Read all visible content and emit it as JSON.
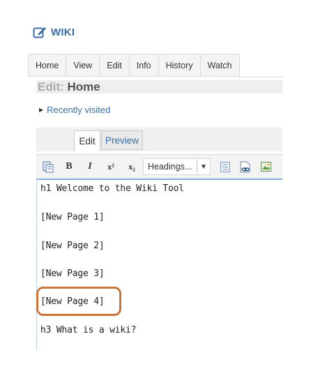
{
  "wiki": {
    "title": "WIKI",
    "icon": "edit-icon"
  },
  "tabs": [
    "Home",
    "View",
    "Edit",
    "Info",
    "History",
    "Watch"
  ],
  "edit_heading": {
    "prefix": "Edit:",
    "page": "Home"
  },
  "recent": {
    "label": "Recently visited"
  },
  "editor_tabs": {
    "edit": "Edit",
    "preview": "Preview"
  },
  "toolbar": {
    "bold": "B",
    "italic": "I",
    "superscript": "x²",
    "subscript": "x₂",
    "headings": "Headings..."
  },
  "content": {
    "lines": [
      "h1 Welcome to the Wiki Tool",
      "[New Page 1]",
      "[New Page 2]",
      "[New Page 3]",
      "[New Page 4]",
      "h3 What is a wiki?"
    ]
  },
  "colors": {
    "link": "#3a6ea5",
    "highlight": "#c8763a"
  }
}
